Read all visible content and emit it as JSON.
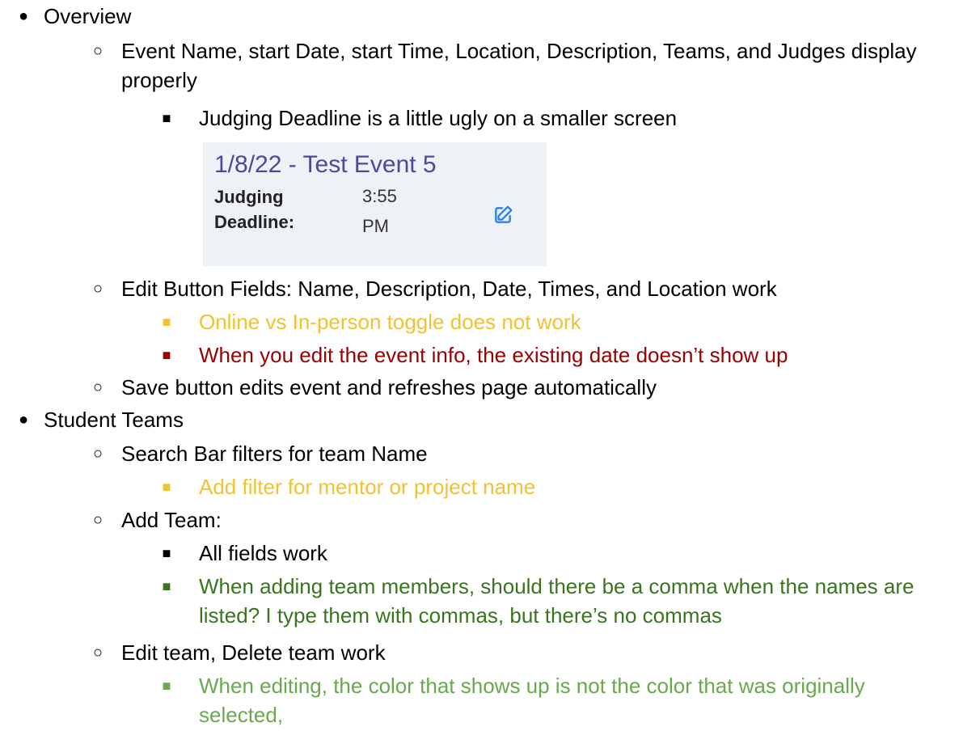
{
  "colors": {
    "text": "#000000",
    "orange": "#f1c232",
    "red": "#990000",
    "dark_green": "#38761d",
    "light_green": "#6aa84f",
    "card_bg": "#eef1f6",
    "card_title": "#4b4a9c",
    "edit_icon": "#2f80ed"
  },
  "icons": {
    "edit": "edit-icon"
  },
  "items": [
    {
      "level": 1,
      "text": "Overview"
    },
    {
      "level": 2,
      "text": "Event Name, start Date, start Time, Location, Description, Teams, and Judges display properly"
    },
    {
      "level": 3,
      "text": "Judging Deadline is a little ugly on a smaller screen"
    },
    {
      "level": 2,
      "text": "Edit Button Fields: Name, Description, Date, Times, and Location work"
    },
    {
      "level": 3,
      "text": "Online vs In-person toggle does not work",
      "color": "#f1c232"
    },
    {
      "level": 3,
      "text": "When you edit the event info, the existing date doesn’t show up",
      "color": "#990000"
    },
    {
      "level": 2,
      "text": "Save button edits event and refreshes page automatically"
    },
    {
      "level": 1,
      "text": "Student Teams"
    },
    {
      "level": 2,
      "text": "Search Bar filters for team Name"
    },
    {
      "level": 3,
      "text": "Add filter for mentor or project name",
      "color": "#f1c232"
    },
    {
      "level": 2,
      "text": "Add Team:"
    },
    {
      "level": 3,
      "text": "All fields work"
    },
    {
      "level": 3,
      "text": "When adding team members, should there be a comma when the names are listed? I type them with commas, but there’s no commas",
      "color": "#38761d"
    },
    {
      "level": 2,
      "text": "Edit team, Delete team work"
    },
    {
      "level": 3,
      "text": "When editing, the color that shows up is not the color that was originally selected,",
      "color": "#6aa84f"
    }
  ],
  "event_card": {
    "title": "1/8/22 - Test Event 5",
    "label": "Judging Deadline:",
    "value": "3:55 PM"
  }
}
